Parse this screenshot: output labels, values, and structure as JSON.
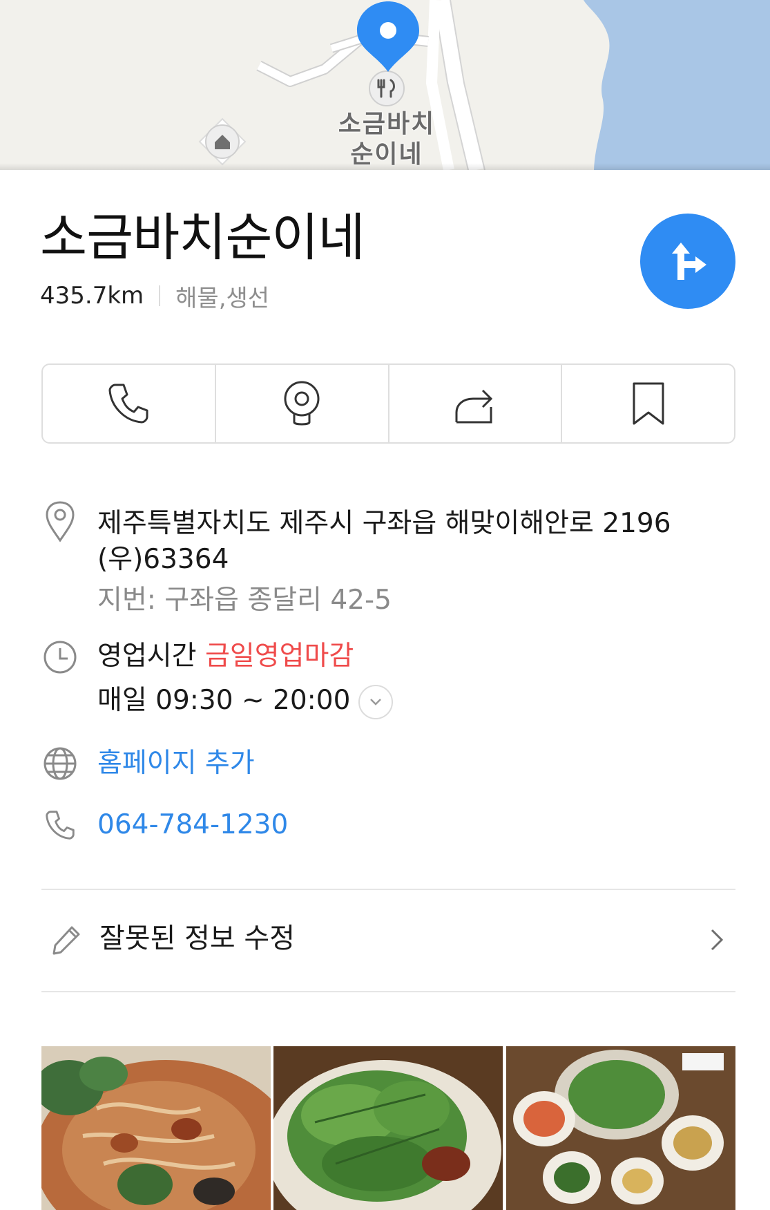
{
  "map": {
    "place_label_line1": "소금바치",
    "place_label_line2": "순이네",
    "icons": [
      "map-pin-icon",
      "restaurant-icon",
      "house-icon"
    ],
    "colors": {
      "land": "#f2f1ec",
      "sea": "#a9c6e6",
      "pin": "#2f8cf3"
    }
  },
  "place": {
    "name": "소금바치순이네",
    "distance": "435.7km",
    "category": "해물,생선"
  },
  "actions": [
    {
      "icon": "phone-icon"
    },
    {
      "icon": "roadview-icon"
    },
    {
      "icon": "share-icon"
    },
    {
      "icon": "bookmark-icon"
    }
  ],
  "info": {
    "address": "제주특별자치도 제주시 구좌읍 해맞이해안로 2196",
    "postal": "(우)63364",
    "lot_address": "지번: 구좌읍 종달리 42-5",
    "hours_label": "영업시간",
    "hours_status": "금일영업마감",
    "hours": "매일 09:30 ~ 20:00",
    "homepage": "홈페이지 추가",
    "phone": "064-784-1230"
  },
  "edit": {
    "label": "잘못된 정보 수정"
  },
  "colors": {
    "accent": "#2f8cf3",
    "link": "#2f88e8",
    "closed": "#ef4b4b"
  }
}
